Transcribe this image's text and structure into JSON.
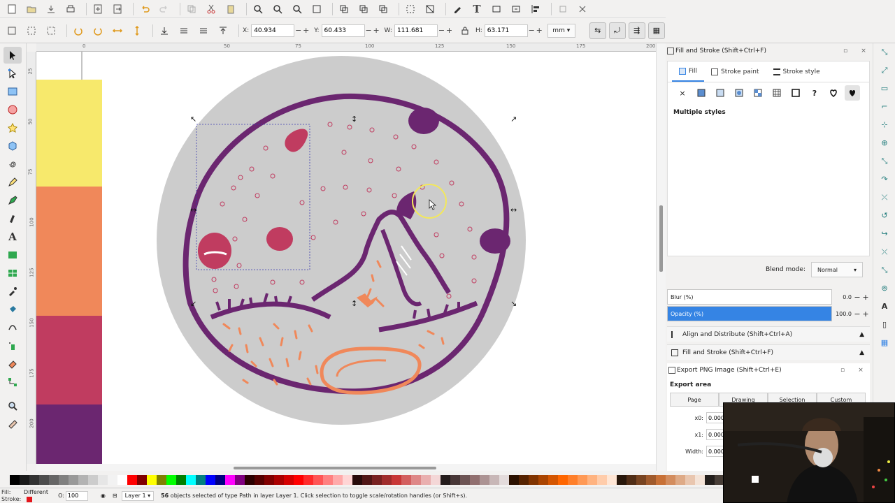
{
  "toolbar": {
    "x_label": "X:",
    "x_value": "40.934",
    "y_label": "Y:",
    "y_value": "60.433",
    "w_label": "W:",
    "w_value": "111.681",
    "h_label": "H:",
    "h_value": "63.171",
    "unit": "mm"
  },
  "rulers": {
    "top": [
      "0",
      "50",
      "75",
      "100",
      "125",
      "150",
      "175",
      "200"
    ],
    "left": [
      "25",
      "50",
      "75",
      "100",
      "125",
      "150",
      "175",
      "200"
    ]
  },
  "fill_stroke": {
    "title": "Fill and Stroke (Shift+Ctrl+F)",
    "tabs": [
      "Fill",
      "Stroke paint",
      "Stroke style"
    ],
    "paint_buttons": [
      "×",
      "?"
    ],
    "message": "Multiple styles",
    "blend_label": "Blend mode:",
    "blend_value": "Normal",
    "blur_label": "Blur (%)",
    "blur_value": "0.0",
    "blur_fraction": 0,
    "opacity_label": "Opacity (%)",
    "opacity_value": "100.0",
    "opacity_fraction": 1
  },
  "collapsed_panels": [
    "Align and Distribute (Shift+Ctrl+A)",
    "Fill and Stroke (Shift+Ctrl+F)"
  ],
  "export": {
    "title": "Export PNG Image (Shift+Ctrl+E)",
    "area_heading": "Export area",
    "tabs": [
      "Page",
      "Drawing",
      "Selection",
      "Custom"
    ],
    "x0_label": "x0:",
    "x0_value": "0.000",
    "x1_label": "x1:",
    "x1_value": "0.000",
    "width_label": "Width:",
    "width_value": "0.000"
  },
  "status": {
    "fill_label": "Fill:",
    "fill_value": "Different",
    "stroke_label": "Stroke:",
    "opacity_label": "O:",
    "opacity_value": "100",
    "layer": "Layer 1",
    "message_count": "56",
    "message_text": " objects selected of type Path in layer Layer 1. Click selection to toggle scale/rotation handles (or Shift+s)."
  },
  "palette_swatches": [
    "#000000",
    "#1a1a1a",
    "#333333",
    "#4d4d4d",
    "#666666",
    "#808080",
    "#999999",
    "#b3b3b3",
    "#cccccc",
    "#e6e6e6",
    "#f2f2f2",
    "#ffffff",
    "#ff0000",
    "#800000",
    "#ffff00",
    "#808000",
    "#00ff00",
    "#008000",
    "#00ffff",
    "#008080",
    "#0000ff",
    "#000080",
    "#ff00ff",
    "#800080",
    "#2b0000",
    "#550000",
    "#800000",
    "#aa0000",
    "#d40000",
    "#ff0000",
    "#ff2a2a",
    "#ff5555",
    "#ff8080",
    "#ffaaaa",
    "#ffd5d5",
    "#280b0b",
    "#501616",
    "#782121",
    "#a02c2c",
    "#c83737",
    "#d35f5f",
    "#de8787",
    "#e9afaf",
    "#f4d7d7",
    "#241c1c",
    "#483737",
    "#6c5353",
    "#916f6f",
    "#ac9393",
    "#c8b7b7",
    "#e3dbdb",
    "#2b1100",
    "#552200",
    "#803300",
    "#aa4400",
    "#d45500",
    "#ff6600",
    "#ff7f2a",
    "#ff9955",
    "#ffb380",
    "#ffccaa",
    "#ffe6d5",
    "#28170b",
    "#502d16",
    "#784421",
    "#a05a2c",
    "#c87137",
    "#d38d5f",
    "#deaa87",
    "#e9c6af",
    "#f4e3d7",
    "#241f1c",
    "#483e37",
    "#6c5d53"
  ],
  "colors": {
    "accent": "#3584e4",
    "plum": "#6b2670",
    "rose": "#c03c60",
    "orange": "#f0885a",
    "grey_circle": "#cccccc"
  },
  "palette_strip_colors": [
    "#f7e96c",
    "#f0885a",
    "#c03c60",
    "#6b2670"
  ]
}
